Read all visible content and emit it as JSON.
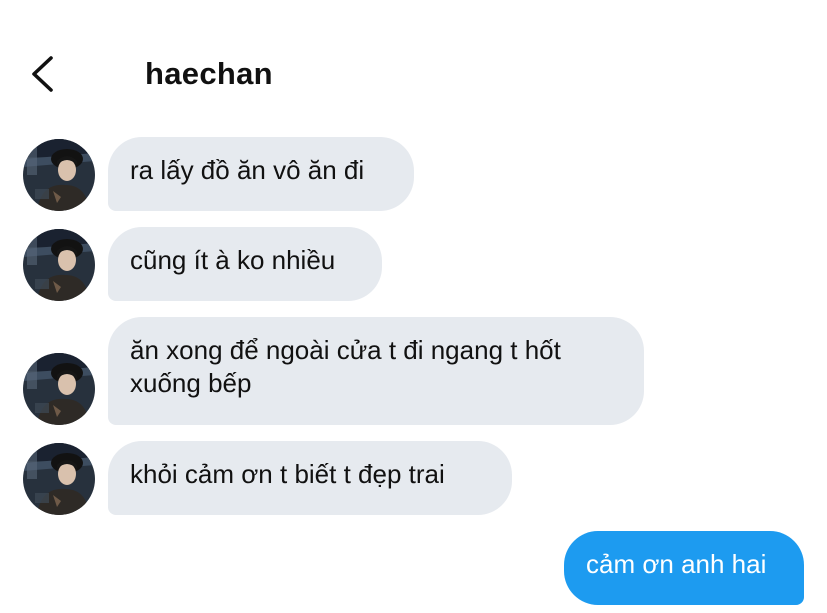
{
  "header": {
    "title": "haechan"
  },
  "icons": {
    "back": "chevron-left-icon",
    "avatar": "profile-photo"
  },
  "colors": {
    "received_bubble": "#e6eaef",
    "sent_bubble": "#1d9bf0",
    "sent_text": "#ffffff",
    "text": "#111111"
  },
  "messages": [
    {
      "sender": "haechan",
      "lines": [
        "ra lấy đồ ăn vô ăn đi"
      ]
    },
    {
      "sender": "haechan",
      "lines": [
        "cũng ít à ko nhiều"
      ]
    },
    {
      "sender": "haechan",
      "lines": [
        "ăn xong để ngoài cửa t đi ngang t hốt",
        "xuống bếp"
      ]
    },
    {
      "sender": "haechan",
      "lines": [
        "khỏi cảm ơn t biết t đẹp trai"
      ]
    },
    {
      "sender": "me",
      "lines": [
        "cảm ơn anh hai"
      ]
    }
  ]
}
